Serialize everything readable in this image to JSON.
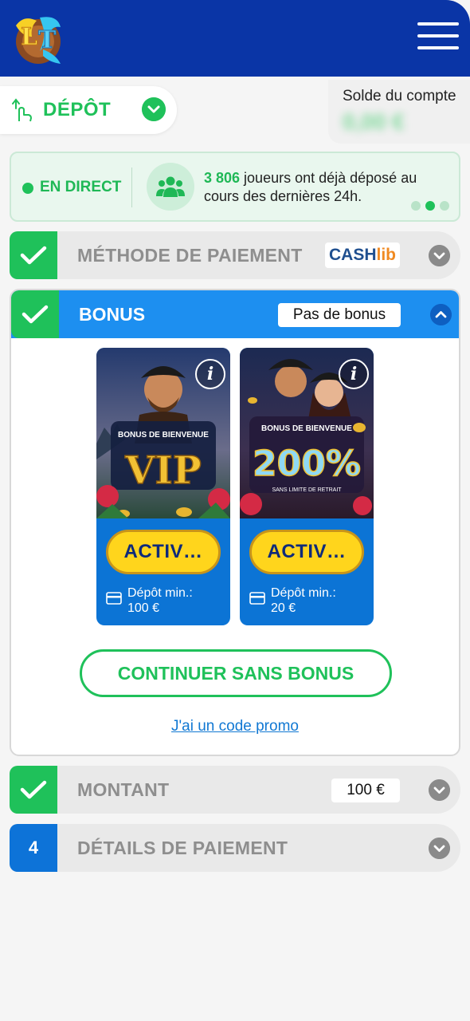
{
  "header": {
    "logo_icon": "lucky-treasure-logo-icon",
    "menu_icon": "hamburger-menu-icon"
  },
  "depot": {
    "label": "DÉPÔT",
    "icon": "deposit-hand-icon",
    "chevron_icon": "chevron-down-icon"
  },
  "balance": {
    "label": "Solde du compte",
    "value": "0,00 €"
  },
  "live": {
    "label": "EN DIRECT",
    "count": "3 806",
    "message": " joueurs ont déjà déposé au cours des dernières 24h.",
    "users_icon": "users-icon",
    "carousel_index": 2,
    "carousel_total": 3
  },
  "steps": {
    "payment_method": {
      "title": "MÉTHODE DE PAIEMENT",
      "provider_part1": "CASH",
      "provider_part2": "lib"
    },
    "bonus": {
      "title": "BONUS",
      "selected": "Pas de bonus"
    },
    "amount": {
      "title": "MONTANT",
      "value": "100 €"
    },
    "details": {
      "number": "4",
      "title": "DÉTAILS DE PAIEMENT"
    }
  },
  "offers": [
    {
      "banner_top": "BONUS DE BIENVENUE",
      "banner_main": "VIP",
      "banner_sub": "",
      "button": "ACTIV…",
      "min_label": "Dépôt min.:",
      "min_value": "100 €"
    },
    {
      "banner_top": "BONUS DE BIENVENUE",
      "banner_main": "200%",
      "banner_sub": "SANS LIMITE DE RETRAIT",
      "button": "ACTIV…",
      "min_label": "Dépôt min.:",
      "min_value": "20 €"
    }
  ],
  "continue_button": "CONTINUER SANS BONUS",
  "promo_link": "J'ai un code promo",
  "colors": {
    "header_bg": "#0a35a6",
    "green": "#1fc15a",
    "blue": "#1d8ff0",
    "yellow": "#ffd51c"
  }
}
